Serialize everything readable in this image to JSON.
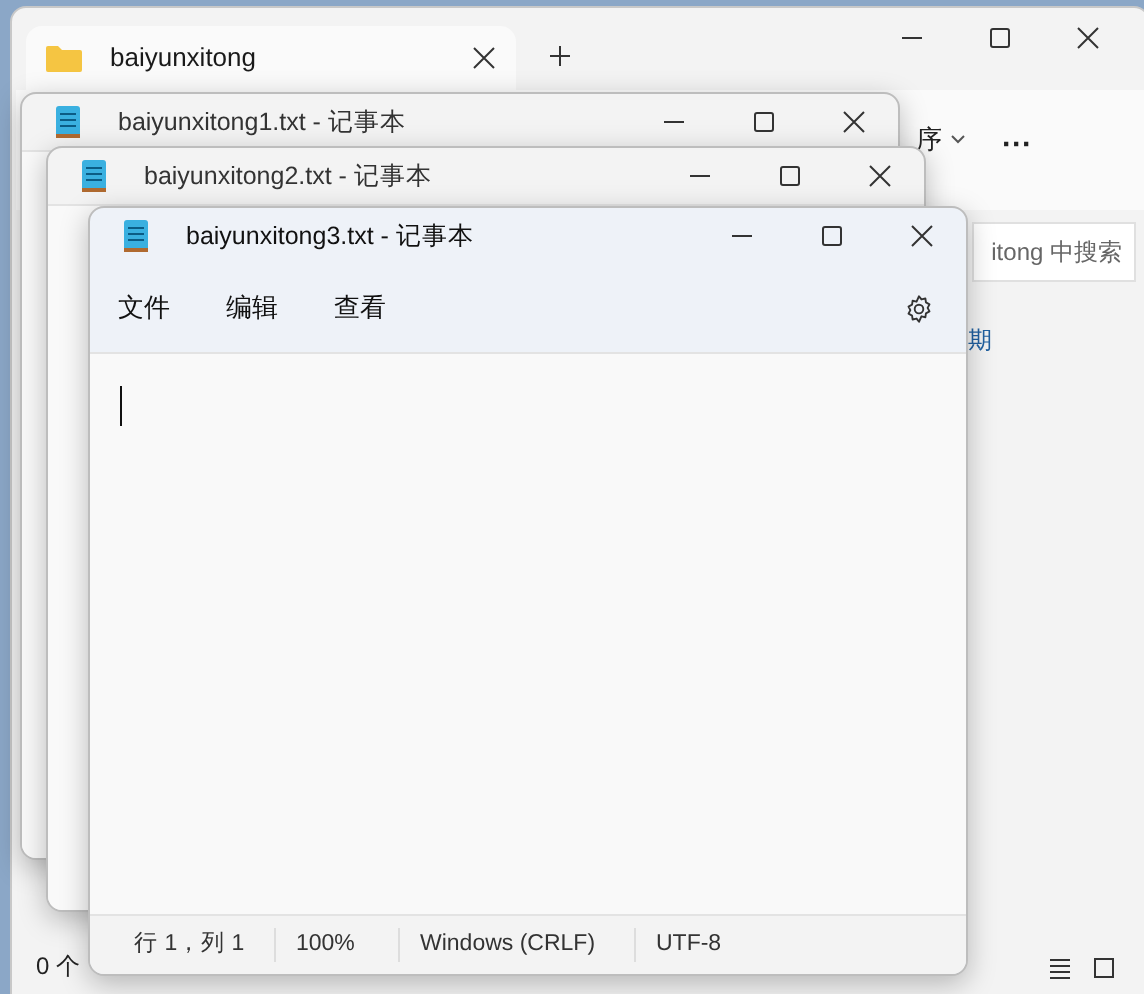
{
  "explorer": {
    "tab": {
      "title": "baiyunxitong",
      "selected": true
    },
    "toolbar": {
      "sort_label": "序",
      "more": "···"
    },
    "search": {
      "placeholder": "itong 中搜索"
    },
    "content_text": "期",
    "status_bar": "0 个"
  },
  "notepads": [
    {
      "title": "baiyunxitong1.txt - 记事本",
      "active": false
    },
    {
      "title": "baiyunxitong2.txt - 记事本",
      "active": false
    },
    {
      "title": "baiyunxitong3.txt - 记事本",
      "active": true,
      "menu": [
        "文件",
        "编辑",
        "查看"
      ],
      "status": [
        "行 1，列 1",
        "100%",
        "Windows (CRLF)",
        "UTF-8"
      ]
    }
  ]
}
